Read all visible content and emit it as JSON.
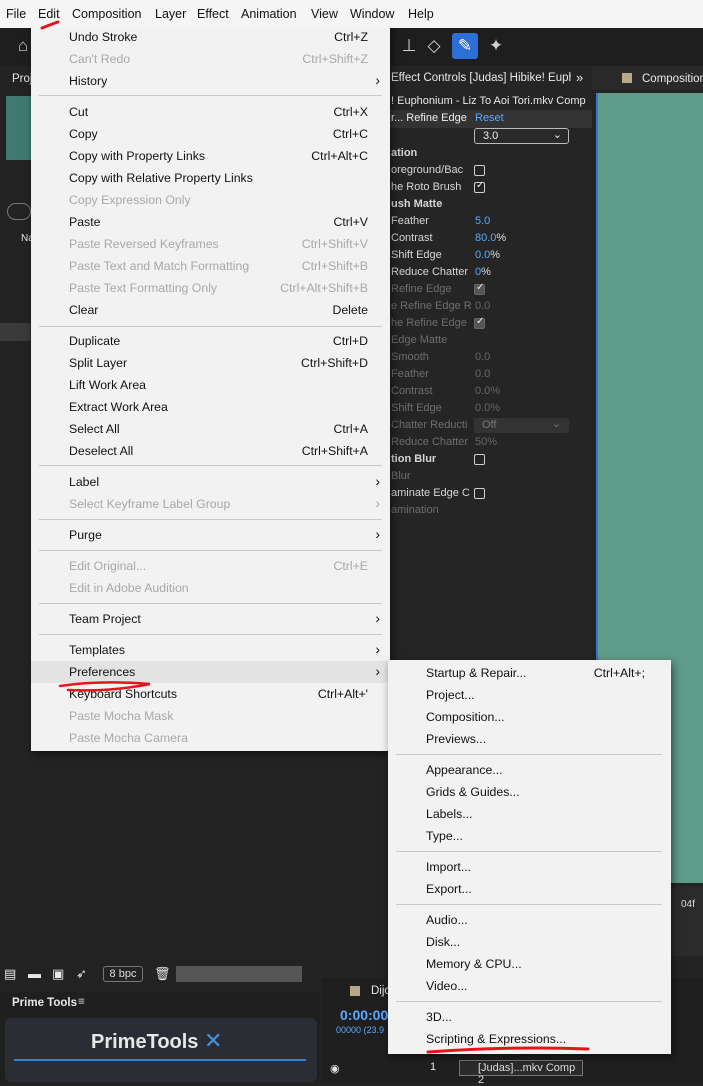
{
  "menubar": {
    "file": "File",
    "edit": "Edit",
    "composition": "Composition",
    "layer": "Layer",
    "effect": "Effect",
    "animation": "Animation",
    "view": "View",
    "window": "Window",
    "help": "Help"
  },
  "project": {
    "tab": "Proj",
    "name_header": "Na"
  },
  "effects": {
    "tab": "Effect Controls [Judas] Hibike! Euphor",
    "comp_path": "! Euphonium - Liz To Aoi Tori.mkv Comp",
    "effect_name": "r... Refine Edge",
    "reset": "Reset",
    "select_value": "3.0",
    "rows": [
      {
        "label": "ation"
      },
      {
        "label": "oreground/Bac"
      },
      {
        "label": "he Roto Brush"
      },
      {
        "label": "ush Matte"
      },
      {
        "label": "Feather",
        "value": "5.0"
      },
      {
        "label": "Contrast",
        "value": "80.0",
        "unit": "%"
      },
      {
        "label": "Shift Edge",
        "value": "0.0",
        "unit": "%"
      },
      {
        "label": "Reduce Chatter",
        "value": "0",
        "unit": "%"
      },
      {
        "label": "Refine Edge"
      },
      {
        "label": "e Refine Edge R",
        "value": "0.0"
      },
      {
        "label": "he Refine Edge"
      },
      {
        "label": "Edge Matte"
      },
      {
        "label": "Smooth",
        "value": "0.0"
      },
      {
        "label": "Feather",
        "value": "0.0"
      },
      {
        "label": "Contrast",
        "value": "0.0%"
      },
      {
        "label": "Shift Edge",
        "value": "0.0%"
      },
      {
        "label": "Chatter Reducti",
        "value": "Off"
      },
      {
        "label": "Reduce Chatter",
        "value": "50%"
      },
      {
        "label": "tion Blur"
      },
      {
        "label": "Blur"
      },
      {
        "label": "aminate Edge C"
      },
      {
        "label": "amination"
      }
    ]
  },
  "composition": {
    "tab": "Composition",
    "frame": "04f"
  },
  "bottom": {
    "bpc": "8 bpc",
    "prime_tools_tab": "Prime Tools",
    "prime_tools_logo": "PrimeTools",
    "timeline_tab": "Dijo",
    "timecode": "0:00:00",
    "frame_info": "00000 (23.9",
    "layer_index": "1",
    "layer_name": "[Judas]...mkv Comp 2"
  },
  "edit_menu": {
    "items": [
      {
        "label": "Undo Stroke",
        "shortcut": "Ctrl+Z"
      },
      {
        "label": "Can't Redo",
        "shortcut": "Ctrl+Shift+Z"
      },
      {
        "label": "History"
      },
      {
        "label": "Cut",
        "shortcut": "Ctrl+X"
      },
      {
        "label": "Copy",
        "shortcut": "Ctrl+C"
      },
      {
        "label": "Copy with Property Links",
        "shortcut": "Ctrl+Alt+C"
      },
      {
        "label": "Copy with Relative Property Links"
      },
      {
        "label": "Copy Expression Only"
      },
      {
        "label": "Paste",
        "shortcut": "Ctrl+V"
      },
      {
        "label": "Paste Reversed Keyframes",
        "shortcut": "Ctrl+Shift+V"
      },
      {
        "label": "Paste Text and Match Formatting",
        "shortcut": "Ctrl+Shift+B"
      },
      {
        "label": "Paste Text Formatting Only",
        "shortcut": "Ctrl+Alt+Shift+B"
      },
      {
        "label": "Clear",
        "shortcut": "Delete"
      },
      {
        "label": "Duplicate",
        "shortcut": "Ctrl+D"
      },
      {
        "label": "Split Layer",
        "shortcut": "Ctrl+Shift+D"
      },
      {
        "label": "Lift Work Area"
      },
      {
        "label": "Extract Work Area"
      },
      {
        "label": "Select All",
        "shortcut": "Ctrl+A"
      },
      {
        "label": "Deselect All",
        "shortcut": "Ctrl+Shift+A"
      },
      {
        "label": "Label"
      },
      {
        "label": "Select Keyframe Label Group"
      },
      {
        "label": "Purge"
      },
      {
        "label": "Edit Original...",
        "shortcut": "Ctrl+E"
      },
      {
        "label": "Edit in Adobe Audition"
      },
      {
        "label": "Team Project"
      },
      {
        "label": "Templates"
      },
      {
        "label": "Preferences"
      },
      {
        "label": "Keyboard Shortcuts",
        "shortcut": "Ctrl+Alt+'"
      },
      {
        "label": "Paste Mocha Mask"
      },
      {
        "label": "Paste Mocha Camera"
      }
    ]
  },
  "preferences_menu": {
    "items": [
      {
        "label": "Startup & Repair...",
        "shortcut": "Ctrl+Alt+;"
      },
      {
        "label": "Project..."
      },
      {
        "label": "Composition..."
      },
      {
        "label": "Previews..."
      },
      {
        "label": "Appearance..."
      },
      {
        "label": "Grids & Guides..."
      },
      {
        "label": "Labels..."
      },
      {
        "label": "Type..."
      },
      {
        "label": "Import..."
      },
      {
        "label": "Export..."
      },
      {
        "label": "Audio..."
      },
      {
        "label": "Disk..."
      },
      {
        "label": "Memory & CPU..."
      },
      {
        "label": "Video..."
      },
      {
        "label": "3D..."
      },
      {
        "label": "Scripting & Expressions..."
      }
    ]
  },
  "colors": {
    "accent": "#5aa9ff",
    "annotation": "#e8141c",
    "canvas": "#5f9c8a"
  }
}
